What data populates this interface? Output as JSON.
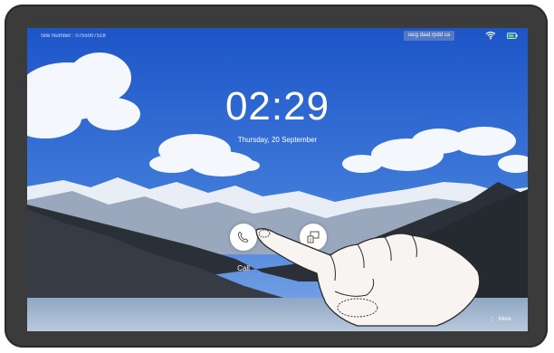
{
  "status_bar": {
    "site_label": "Site Number : ",
    "site_value": "0755007518",
    "device_name": "iacg daat rpdd ca",
    "wifi_icon": "wifi-icon",
    "battery_icon": "battery-icon",
    "battery_color": "#4cd964"
  },
  "lock_screen": {
    "time": "02:29",
    "date": "Thursday, 20 September"
  },
  "actions": {
    "call_label": "Call",
    "call_icon": "phone-icon",
    "share_icon": "screen-share-icon"
  },
  "footer": {
    "more_label": "More",
    "more_icon": "vertical-dots-icon"
  },
  "colors": {
    "sky_top": "#1f5ccf",
    "sky_bottom": "#5a8fe2",
    "bezel": "#3b3b3b"
  }
}
